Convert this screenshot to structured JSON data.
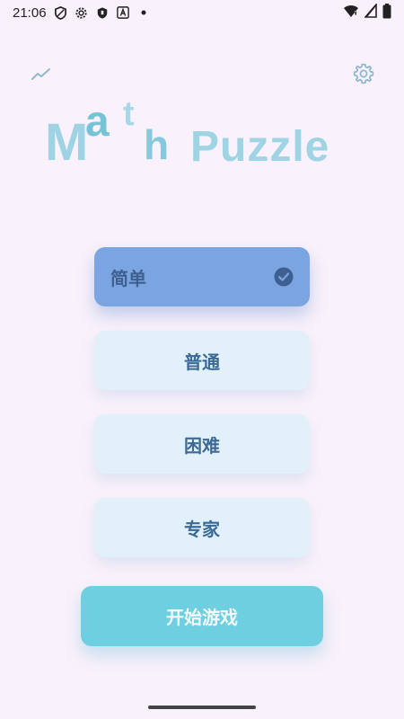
{
  "status_bar": {
    "time": "21:06",
    "icons": [
      "shield-icon",
      "gear-icon",
      "shield-filled-icon",
      "font-a-icon",
      "dot-icon"
    ],
    "right_icons": [
      "wifi-icon",
      "signal-icon",
      "battery-icon"
    ]
  },
  "toolbar": {
    "stats_icon": "trending-icon",
    "settings_icon": "gear-icon"
  },
  "title": {
    "part1_letters": [
      "M",
      "a",
      "t",
      "h"
    ],
    "part2": "Puzzle"
  },
  "difficulties": [
    {
      "label": "简单",
      "selected": true
    },
    {
      "label": "普通",
      "selected": false
    },
    {
      "label": "困难",
      "selected": false
    },
    {
      "label": "专家",
      "selected": false
    }
  ],
  "start_button": {
    "label": "开始游戏"
  },
  "colors": {
    "background": "#f9f1fb",
    "selected": "#7aa5e1",
    "option": "#e2f0fa",
    "start": "#6dcfe0",
    "icon": "#8fb8cc"
  }
}
